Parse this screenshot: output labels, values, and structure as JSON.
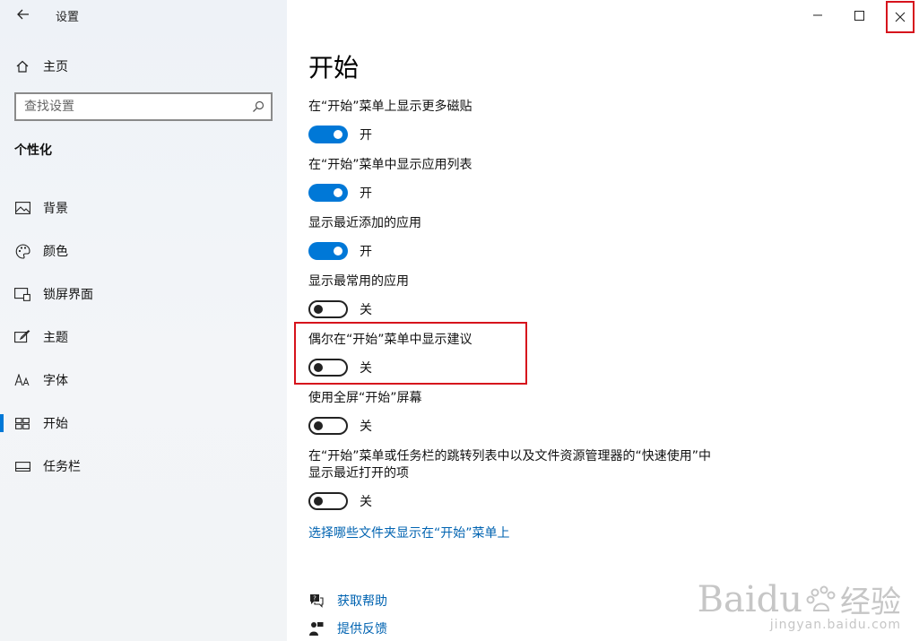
{
  "window": {
    "title": "设置"
  },
  "sidebar": {
    "home_label": "主页",
    "search_placeholder": "查找设置",
    "section_title": "个性化",
    "items": [
      {
        "label": "背景",
        "icon": "picture-icon"
      },
      {
        "label": "颜色",
        "icon": "palette-icon"
      },
      {
        "label": "锁屏界面",
        "icon": "lock-screen-icon"
      },
      {
        "label": "主题",
        "icon": "brush-icon"
      },
      {
        "label": "字体",
        "icon": "font-icon"
      },
      {
        "label": "开始",
        "icon": "start-icon",
        "active": true
      },
      {
        "label": "任务栏",
        "icon": "taskbar-icon"
      }
    ]
  },
  "main": {
    "title": "开始",
    "settings": [
      {
        "label": "在“开始”菜单上显示更多磁贴",
        "state": "开",
        "on": true
      },
      {
        "label": "在“开始”菜单中显示应用列表",
        "state": "开",
        "on": true
      },
      {
        "label": "显示最近添加的应用",
        "state": "开",
        "on": true
      },
      {
        "label": "显示最常用的应用",
        "state": "关",
        "on": false
      },
      {
        "label": "偶尔在“开始”菜单中显示建议",
        "state": "关",
        "on": false
      },
      {
        "label": "使用全屏“开始”屏幕",
        "state": "关",
        "on": false
      },
      {
        "label": "在“开始”菜单或任务栏的跳转列表中以及文件资源管理器的“快速使用”中显示最近打开的项",
        "state": "关",
        "on": false
      }
    ],
    "folders_link": "选择哪些文件夹显示在“开始”菜单上",
    "help_label": "获取帮助",
    "feedback_label": "提供反馈"
  },
  "watermark": {
    "brand": "Baidu",
    "brand_cn": "经验",
    "url": "jingyan.baidu.com"
  },
  "colors": {
    "accent": "#0078d7",
    "link": "#0063b1",
    "highlight": "#d6131c"
  }
}
